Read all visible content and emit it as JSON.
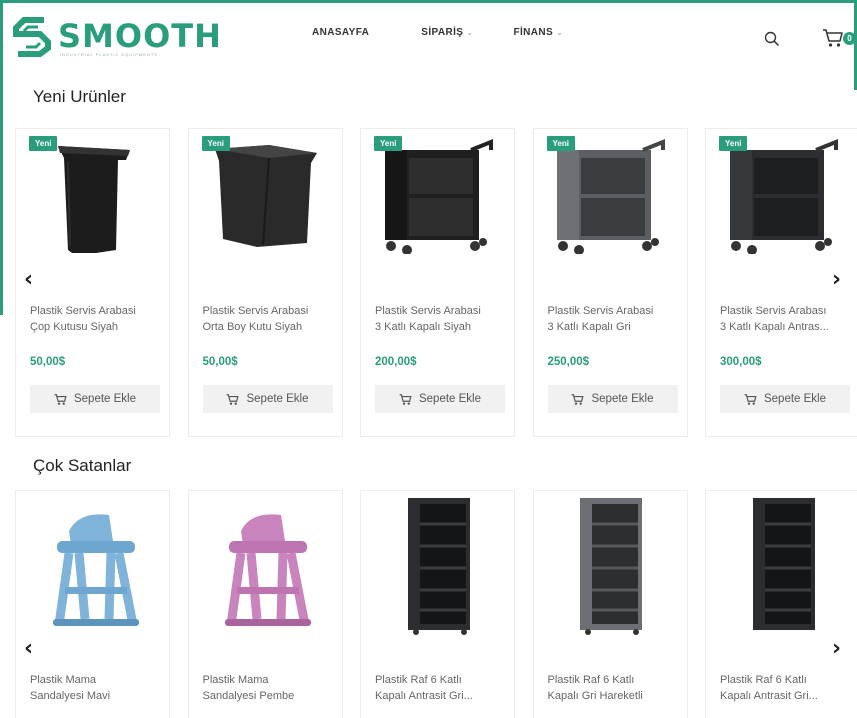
{
  "header": {
    "logo_text": "SMOOTH",
    "logo_tagline": "INDUSTRIAL PLASTIC EQUIPMENTS",
    "nav": [
      {
        "label": "ANASAYFA",
        "has_dropdown": false
      },
      {
        "label": "SİPARİŞ",
        "has_dropdown": true
      },
      {
        "label": "FİNANS",
        "has_dropdown": true
      }
    ],
    "search_icon": "search-icon",
    "cart_icon": "cart-icon",
    "cart_count": "0"
  },
  "colors": {
    "accent": "#2a9d7c",
    "button_bg": "#f1f1f1"
  },
  "sections": [
    {
      "title": "Yeni Urünler",
      "prev_icon": "chevron-left-icon",
      "next_icon": "chevron-right-icon",
      "products": [
        {
          "badge": "Yeni",
          "name_line1": "Plastik Servis Arabasi",
          "name_line2": "Çop Kutusu Siyah",
          "price": "50,00$",
          "button": "Sepete Ekle",
          "image": "black-bin"
        },
        {
          "badge": "Yeni",
          "name_line1": "Plastik Servis Arabasi",
          "name_line2": "Orta Boy Kutu Siyah",
          "price": "50,00$",
          "button": "Sepete Ekle",
          "image": "black-box"
        },
        {
          "badge": "Yeni",
          "name_line1": "Plastik Servis Arabasi",
          "name_line2": "3 Katlı Kapalı Siyah",
          "price": "200,00$",
          "button": "Sepete Ekle",
          "image": "cart-black"
        },
        {
          "badge": "Yeni",
          "name_line1": "Plastik Servis Arabasi",
          "name_line2": "3 Katlı Kapalı Gri",
          "price": "250,00$",
          "button": "Sepete Ekle",
          "image": "cart-grey"
        },
        {
          "badge": "Yeni",
          "name_line1": "Plastik Servis Arabası",
          "name_line2": "3 Katlı Kapalı Antras...",
          "price": "300,00$",
          "button": "Sepete Ekle",
          "image": "cart-anthracite"
        }
      ]
    },
    {
      "title": "Çok Satanlar",
      "prev_icon": "chevron-left-icon",
      "next_icon": "chevron-right-icon",
      "products": [
        {
          "name_line1": "Plastik Mama",
          "name_line2": "Sandalyesi Mavi",
          "image": "highchair-blue"
        },
        {
          "name_line1": "Plastik Mama",
          "name_line2": "Sandalyesi Pembe",
          "image": "highchair-pink"
        },
        {
          "name_line1": "Plastik Raf 6 Katlı",
          "name_line2": "Kapalı Antrasit Gri...",
          "image": "shelf-anthracite"
        },
        {
          "name_line1": "Plastik Raf 6 Katlı",
          "name_line2": "Kapalı Gri Hareketli",
          "image": "shelf-grey"
        },
        {
          "name_line1": "Plastik Raf 6 Katlı",
          "name_line2": "Kapalı Antrasit Gri...",
          "image": "shelf-anthracite-2"
        }
      ]
    }
  ]
}
